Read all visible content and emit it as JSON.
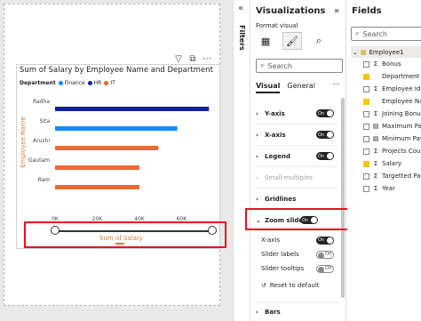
{
  "visual_toolbar": {
    "filter_icon": "filter-icon",
    "focus_icon": "focus-mode-icon",
    "more_icon": "more-options-icon"
  },
  "chart": {
    "title": "Sum of Salary by Employee Name and Department",
    "legend_title": "Department",
    "legend": [
      {
        "name": "Finance",
        "color": "#118dff"
      },
      {
        "name": "HR",
        "color": "#12239e"
      },
      {
        "name": "IT",
        "color": "#e66c37"
      }
    ],
    "y_axis_title": "Employee Name",
    "x_axis_title": "Sum of Salary"
  },
  "chart_data": {
    "type": "bar",
    "orientation": "horizontal",
    "title": "Sum of Salary by Employee Name and Department",
    "xlabel": "Sum of Salary",
    "ylabel": "Employee Name",
    "categories": [
      "Radha",
      "Sita",
      "Arushi",
      "Gautam",
      "Ram"
    ],
    "values": [
      73000,
      58000,
      49000,
      40000,
      40000
    ],
    "colors": [
      "#12239e",
      "#118dff",
      "#e66c37",
      "#e66c37",
      "#e66c37"
    ],
    "x_ticks": [
      "0K",
      "20K",
      "40K",
      "60K"
    ],
    "xlim": [
      0,
      75000
    ],
    "grid": false
  },
  "filters_pane": {
    "label": "Filters",
    "collapse_icon": "double-chevron-left-icon"
  },
  "viz_pane": {
    "title": "Visualizations",
    "format_label": "Format visual",
    "search_placeholder": "Search",
    "tabs": [
      "Visual",
      "General"
    ],
    "cards": [
      {
        "label": "Y-axis",
        "toggle": "On",
        "enabled": true
      },
      {
        "label": "X-axis",
        "toggle": "On",
        "enabled": true
      },
      {
        "label": "Legend",
        "toggle": "On",
        "enabled": true
      },
      {
        "label": "Small multiples",
        "toggle": "",
        "enabled": false
      },
      {
        "label": "Gridlines",
        "toggle": "",
        "enabled": true
      },
      {
        "label": "Zoom slider",
        "toggle": "On",
        "enabled": true
      }
    ],
    "zoom_options": [
      {
        "label": "X-axis",
        "toggle": "On"
      },
      {
        "label": "Slider labels",
        "toggle": "Off"
      },
      {
        "label": "Slider tooltips",
        "toggle": "Off"
      }
    ],
    "reset_label": "Reset to default",
    "bars_label": "Bars"
  },
  "fields_pane": {
    "title": "Fields",
    "search_placeholder": "Search",
    "table": "Employee1",
    "fields": [
      {
        "name": "Bonus",
        "checked": false,
        "type": "sigma"
      },
      {
        "name": "Department",
        "checked": true,
        "type": "text"
      },
      {
        "name": "Employee Id",
        "checked": false,
        "type": "sigma"
      },
      {
        "name": "Employee Name",
        "checked": true,
        "type": "text"
      },
      {
        "name": "Joining Bonus",
        "checked": false,
        "type": "sigma"
      },
      {
        "name": "Maximum Pay",
        "checked": false,
        "type": "calc"
      },
      {
        "name": "Minimum Pay",
        "checked": false,
        "type": "calc"
      },
      {
        "name": "Projects Count",
        "checked": false,
        "type": "sigma"
      },
      {
        "name": "Salary",
        "checked": true,
        "type": "sigma"
      },
      {
        "name": "Targetted Pay",
        "checked": false,
        "type": "sigma"
      },
      {
        "name": "Year",
        "checked": false,
        "type": "sigma"
      }
    ]
  }
}
